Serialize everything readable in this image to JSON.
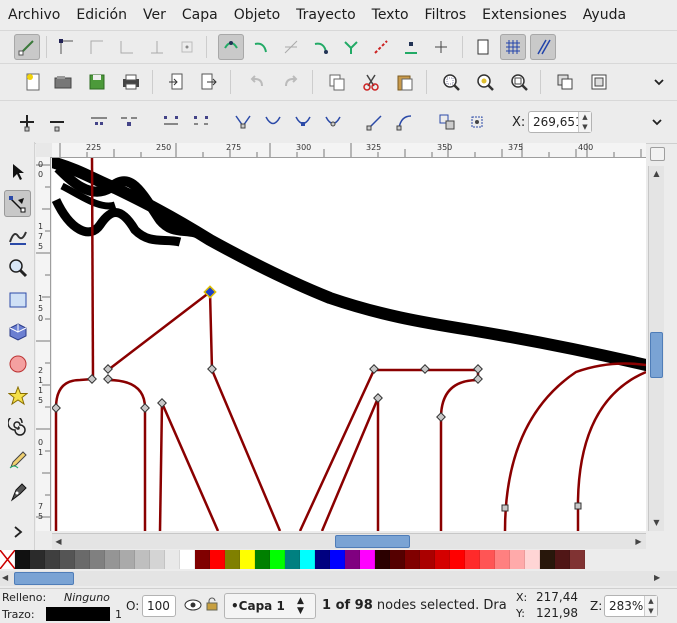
{
  "menu": [
    "Archivo",
    "Edición",
    "Ver",
    "Capa",
    "Objeto",
    "Trayecto",
    "Texto",
    "Filtros",
    "Extensiones",
    "Ayuda"
  ],
  "coords": {
    "x_label": "X:",
    "x_value": "269,651"
  },
  "rulers": {
    "h_ticks": [
      "225",
      "250",
      "275",
      "300",
      "325",
      "350",
      "375",
      "400"
    ],
    "v_ticks": [
      "0",
      "0",
      "1",
      "7",
      "5",
      "1",
      "5",
      "0",
      "2",
      "1",
      "1",
      "5",
      "0",
      "1",
      "7",
      "5"
    ]
  },
  "palette": [
    "#111111",
    "#2b2b2b",
    "#3f3f3f",
    "#555555",
    "#6a6a6a",
    "#808080",
    "#959595",
    "#aaaaaa",
    "#bfbfbf",
    "#d4d4d4",
    "#e9e9e9",
    "#ffffff",
    "#800000",
    "#ff0000",
    "#808000",
    "#ffff00",
    "#008000",
    "#00ff00",
    "#008080",
    "#00ffff",
    "#000080",
    "#0000ff",
    "#800080",
    "#ff00ff",
    "#2b0000",
    "#550000",
    "#800000",
    "#aa0000",
    "#d40000",
    "#ff0000",
    "#ff2a2a",
    "#ff5555",
    "#ff8080",
    "#ffaaaa",
    "#ffd5d5",
    "#28170b",
    "#501616",
    "#803333"
  ],
  "status": {
    "fill_label": "Relleno:",
    "fill_value": "Ninguno",
    "stroke_label": "Trazo:",
    "stroke_width": "1",
    "opacity_label": "O:",
    "opacity_value": "100",
    "layer": "•Capa 1",
    "message_bold": "1 of 98",
    "message": " nodes selected. Dra",
    "cursor_x_label": "X:",
    "cursor_x": "217,44",
    "cursor_y_label": "Y:",
    "cursor_y": "121,98",
    "zoom_label": "Z:",
    "zoom": "283%"
  },
  "colors": {
    "path_stroke": "#7a0000",
    "node_fill": "#c8c8c8",
    "selected_node": "#1e40c8"
  }
}
